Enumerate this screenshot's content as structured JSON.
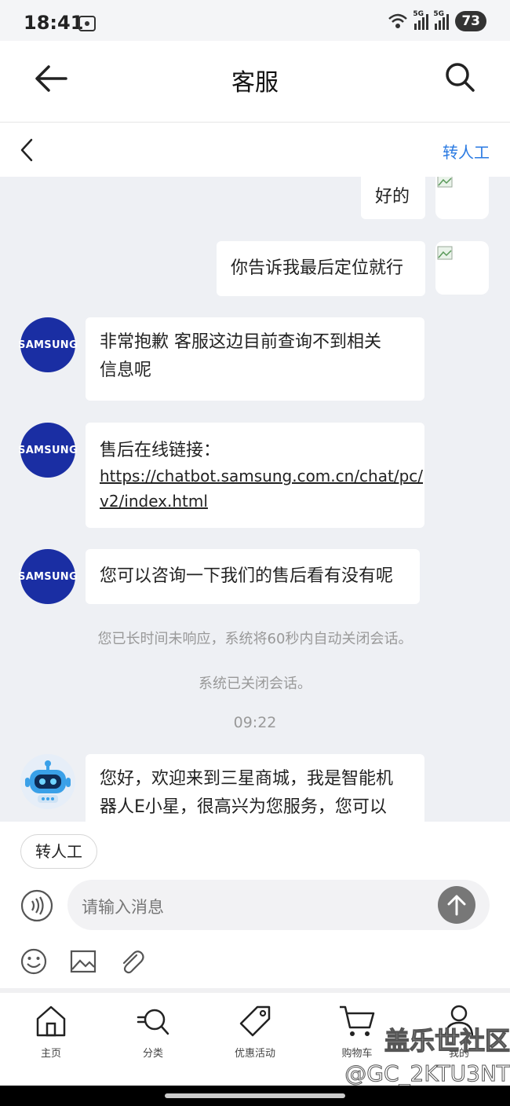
{
  "status_bar": {
    "time": "18:41",
    "battery": "73",
    "net1": "5G",
    "net2": "5G"
  },
  "header": {
    "title": "客服"
  },
  "subheader": {
    "transfer_label": "转人工"
  },
  "messages": {
    "user1": "好的",
    "user2": "你告诉我最后定位就行",
    "bot_logo_text": "SAMSUNG",
    "bot1_line1": "非常抱歉 客服这边目前查询不到相关",
    "bot1_line2": "信息呢",
    "bot2_line1": "售后在线链接：",
    "bot2_link_line1": "https://chatbot.samsung.com.cn/chat/pc/",
    "bot2_link_line2": "v2/index.html",
    "bot3": "您可以咨询一下我们的售后看有没有呢",
    "sys1": "您已长时间未响应，系统将60秒内自动关闭会话。",
    "sys2": "系统已关闭会话。",
    "timestamp": "09:22",
    "bot4_line1": "您好，欢迎来到三星商城，我是智能机",
    "bot4_line2": "器人E小星，很高兴为您服务，您可以"
  },
  "input": {
    "quick_reply": "转人工",
    "placeholder": "请输入消息"
  },
  "nav": {
    "items": [
      {
        "label": "主页",
        "icon": "home-icon"
      },
      {
        "label": "分类",
        "icon": "category-search-icon"
      },
      {
        "label": "优惠活动",
        "icon": "tag-icon"
      },
      {
        "label": "购物车",
        "icon": "cart-icon"
      },
      {
        "label": "我的",
        "icon": "user-icon"
      }
    ]
  },
  "watermark": {
    "line1": "盖乐世社区",
    "line2": "@GC_2KTU3NT"
  },
  "colors": {
    "accent": "#2a7ae2",
    "chat_bg": "#eef0f4",
    "samsung_blue": "#1a2ea3"
  }
}
